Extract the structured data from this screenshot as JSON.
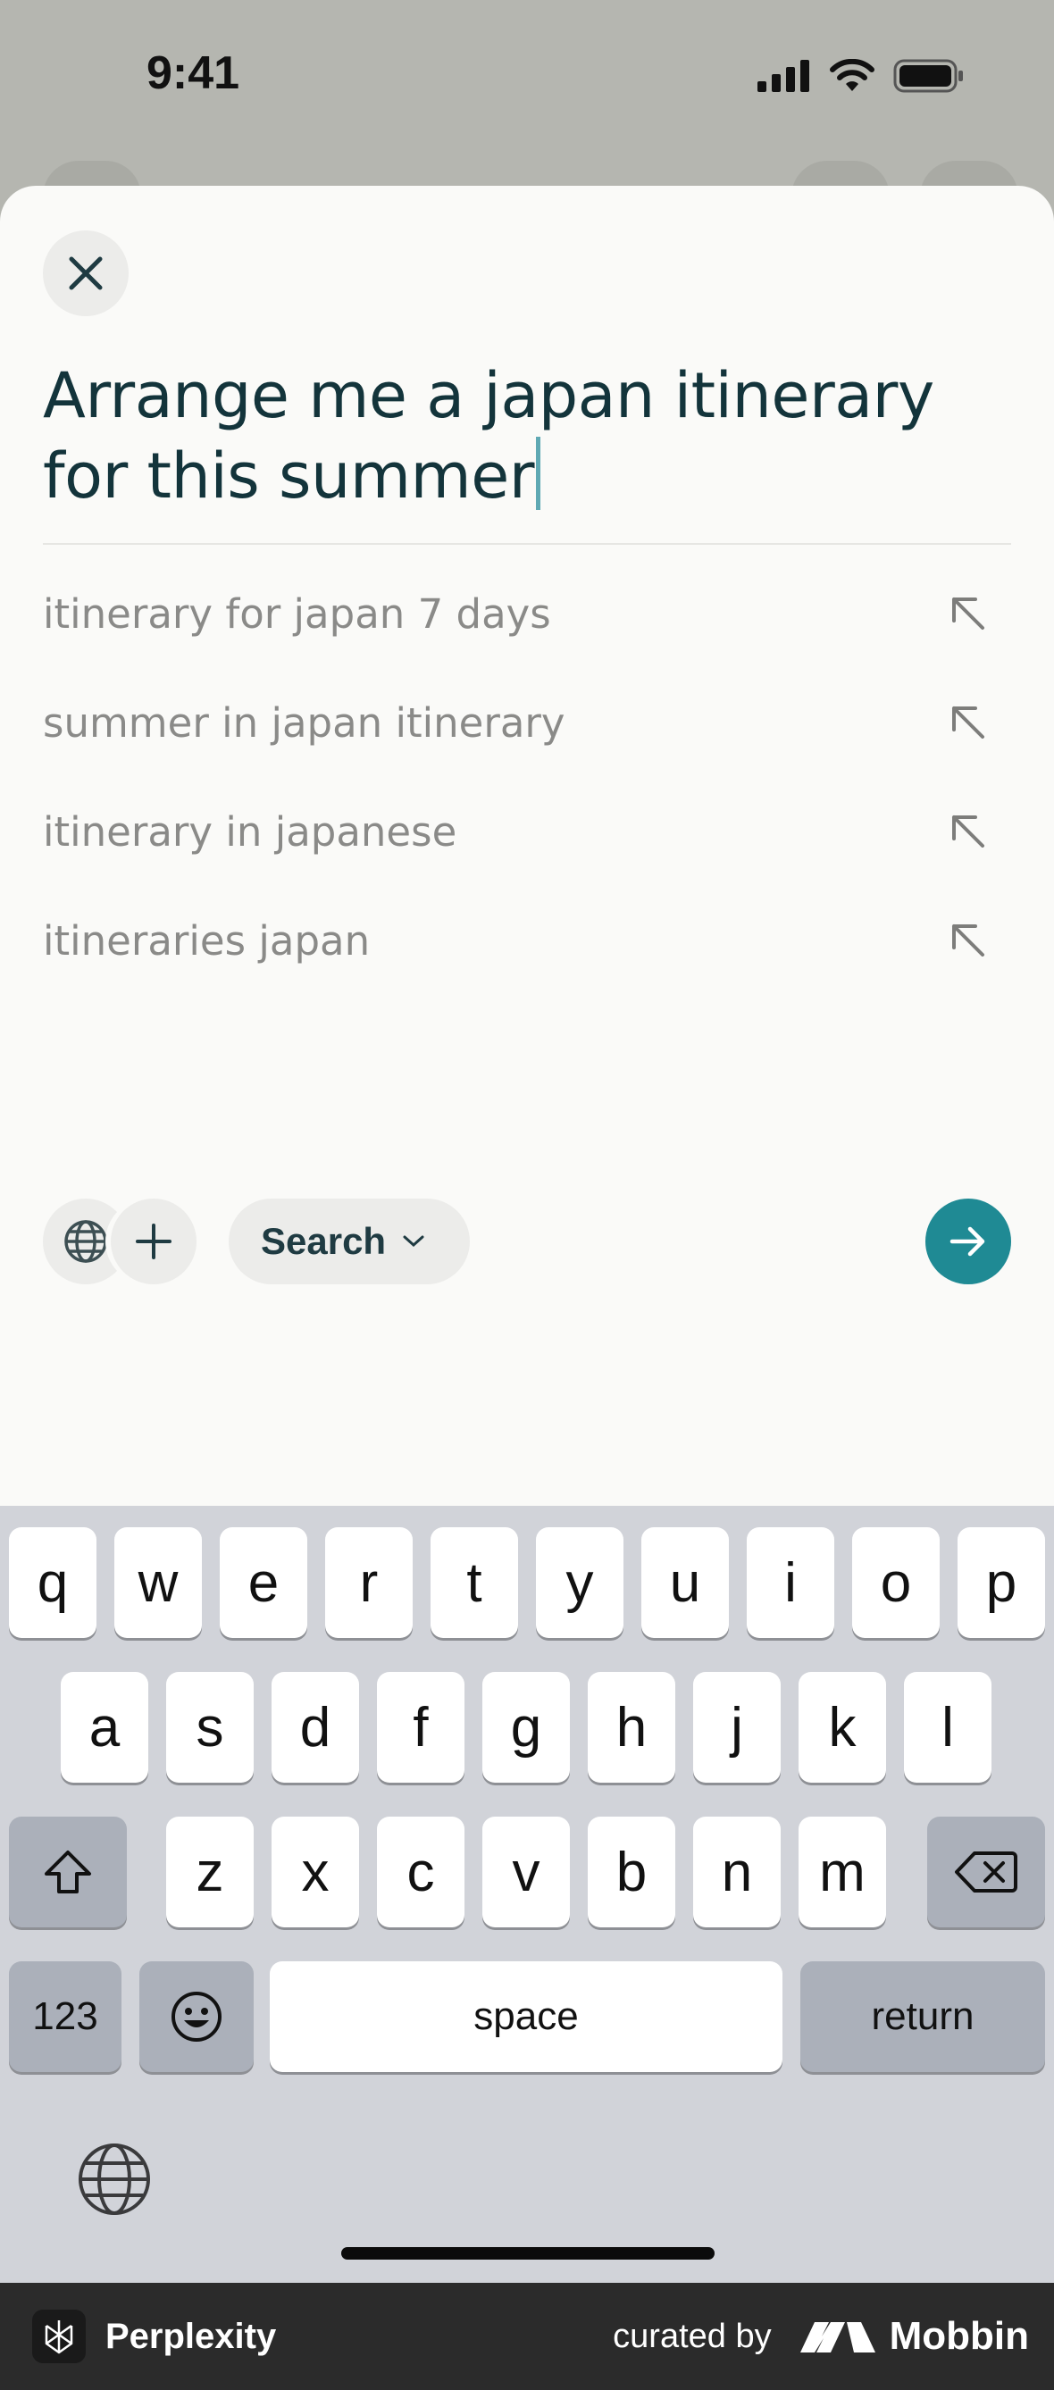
{
  "status_bar": {
    "time": "9:41"
  },
  "query": {
    "text": "Arrange me a japan itinerary for this summer"
  },
  "suggestions": [
    "itinerary for japan 7 days",
    "summer in japan itinerary",
    "itinerary in japanese",
    "itineraries japan"
  ],
  "composer": {
    "mode_label": "Search"
  },
  "keyboard": {
    "row1": [
      "q",
      "w",
      "e",
      "r",
      "t",
      "y",
      "u",
      "i",
      "o",
      "p"
    ],
    "row2": [
      "a",
      "s",
      "d",
      "f",
      "g",
      "h",
      "j",
      "k",
      "l"
    ],
    "row3": [
      "z",
      "x",
      "c",
      "v",
      "b",
      "n",
      "m"
    ],
    "numbers_label": "123",
    "space_label": "space",
    "return_label": "return"
  },
  "footer": {
    "app_name": "Perplexity",
    "curated_label": "curated by",
    "brand": "Mobbin"
  },
  "colors": {
    "accent": "#1f8a94",
    "query_text": "#13343b",
    "suggestion_text": "#8a8a88"
  }
}
